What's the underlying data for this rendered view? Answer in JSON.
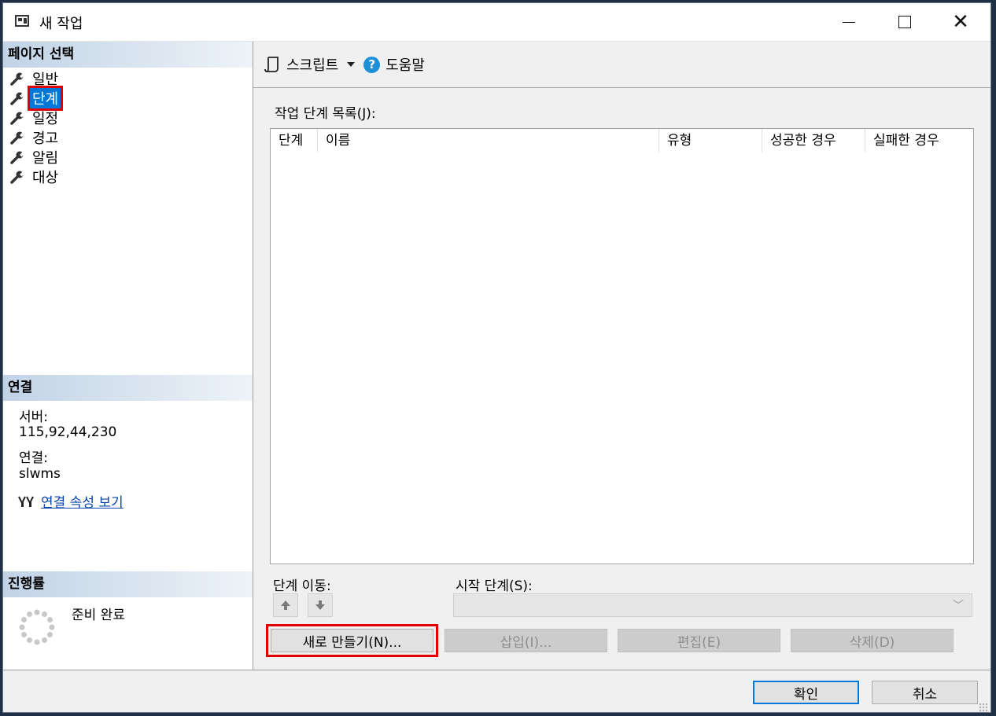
{
  "window": {
    "title": "새 작업"
  },
  "left": {
    "page_select_header": "페이지 선택",
    "pages": [
      {
        "label": "일반",
        "selected": false
      },
      {
        "label": "단계",
        "selected": true
      },
      {
        "label": "일정",
        "selected": false
      },
      {
        "label": "경고",
        "selected": false
      },
      {
        "label": "알림",
        "selected": false
      },
      {
        "label": "대상",
        "selected": false
      }
    ],
    "connection_header": "연결",
    "server_label": "서버:",
    "server_value": "115,92,44,230",
    "connection_label": "연결:",
    "connection_value": "slwms",
    "view_props_link": "연결 속성 보기",
    "progress_header": "진행률",
    "progress_status": "준비 완료"
  },
  "toolbar": {
    "script_label": "스크립트",
    "help_label": "도움말"
  },
  "main": {
    "step_list_label": "작업 단계 목록(J):",
    "columns": [
      "단계",
      "이름",
      "유형",
      "성공한 경우",
      "실패한 경우"
    ],
    "move_step_label": "단계 이동:",
    "start_step_label": "시작 단계(S):",
    "start_step_value": "",
    "buttons": {
      "new": "새로 만들기(N)...",
      "insert": "삽입(I)...",
      "edit": "편집(E)",
      "delete": "삭제(D)"
    }
  },
  "footer": {
    "ok": "확인",
    "cancel": "취소"
  },
  "colors": {
    "selection": "#0078d7",
    "highlight_box": "#e00000",
    "link": "#0645ad",
    "help_icon": "#1e90d8"
  }
}
